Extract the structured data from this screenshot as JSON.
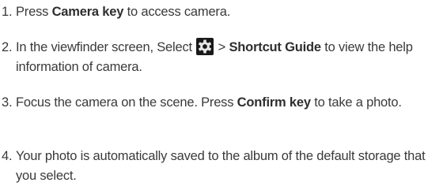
{
  "steps": [
    {
      "number": "1.",
      "pre": "Press ",
      "bold": "Camera key",
      "post": " to access camera."
    },
    {
      "number": "2.",
      "pre": "In the viewfinder screen, Select ",
      "icon": "camera-settings-gear-icon",
      "mid": " > ",
      "bold": "Shortcut Guide",
      "post": " to view the help information of camera."
    },
    {
      "number": "3.",
      "pre": "Focus the camera on the scene. Press ",
      "bold": "Confirm key",
      "post": " to take a photo."
    },
    {
      "number": "4.",
      "text": "Your photo is automatically saved to the album of the default storage that you select."
    }
  ],
  "colors": {
    "text": "#3a3a3a",
    "icon_bg": "#1a1a1a",
    "icon_fg": "#e8e8e8"
  }
}
